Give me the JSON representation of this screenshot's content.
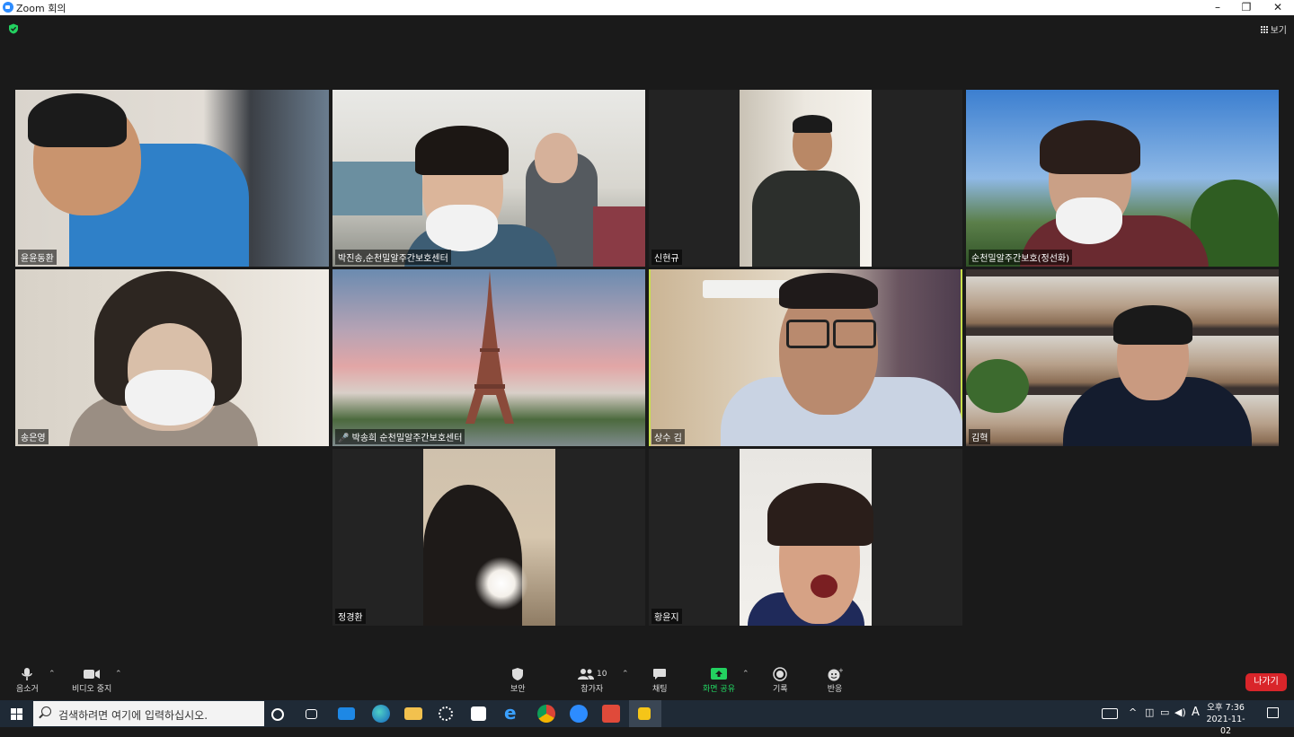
{
  "window": {
    "title": "Zoom 회의"
  },
  "view_button": {
    "label": "보기"
  },
  "participants": [
    {
      "name": "윤윤동환"
    },
    {
      "name": "박진송,순천밀알주간보호센터"
    },
    {
      "name": "신현규"
    },
    {
      "name": "순천밀알주간보호(정선화)"
    },
    {
      "name": "송은영"
    },
    {
      "name": "박송희 순천밀알주간보호센터"
    },
    {
      "name": "상수 김"
    },
    {
      "name": "김혁"
    },
    {
      "name": "정경환"
    },
    {
      "name": "황윤지"
    }
  ],
  "toolbar": {
    "mute": "음소거",
    "video": "비디오 중지",
    "security": "보안",
    "participants": "참가자",
    "participants_count": "10",
    "chat": "채팅",
    "share": "화면 공유",
    "record": "기록",
    "reactions": "반응",
    "leave": "나가기"
  },
  "taskbar": {
    "search_placeholder": "검색하려면 여기에 입력하십시오.",
    "ime": "A",
    "time": "오후 7:36",
    "date": "2021-11-02"
  },
  "colors": {
    "speaking_border": "#c8e04a",
    "leave_button": "#d9252a",
    "share_icon": "#23d160",
    "zoom_blue": "#2d8cff"
  }
}
